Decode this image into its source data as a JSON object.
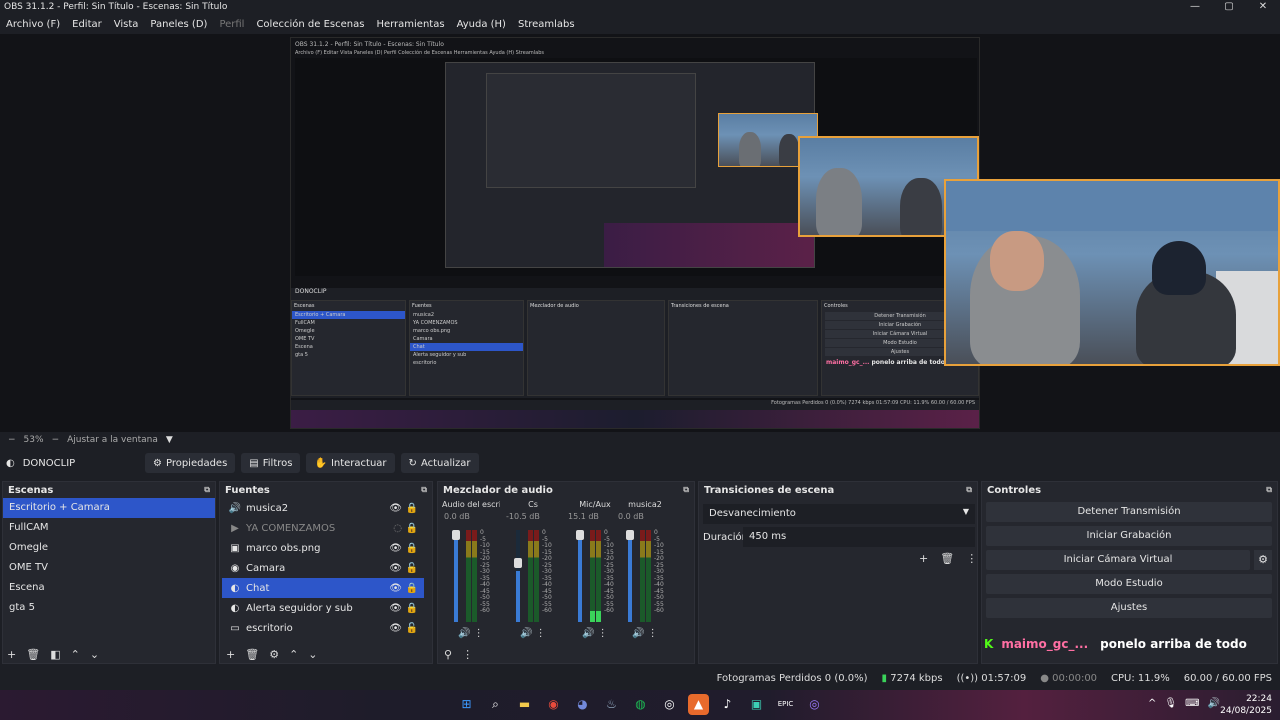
{
  "window": {
    "title": "OBS 31.1.2 - Perfil: Sin Título - Escenas: Sin Título",
    "controls": [
      "—",
      "▢",
      "✕"
    ]
  },
  "menu": [
    "Archivo (F)",
    "Editar",
    "Vista",
    "Paneles (D)",
    "Perfil",
    "Colección de Escenas",
    "Herramientas",
    "Ayuda (H)",
    "Streamlabs"
  ],
  "preview": {
    "nested_title": "OBS 31.1.2 - Perfil: Sin Título - Escenas: Sin Título",
    "nested_menu": "Archivo (F)  Editar  Vista  Paneles (D)  Perfil  Colección de Escenas  Herramientas  Ayuda (H)  Streamlabs",
    "nested_status": "Fotogramas Perdidos 0 (0.0%)   7274 kbps   01:57:09   CPU: 11.9%   60.00 / 60.00 FPS",
    "nested_chat_user": "maimo_gc_...",
    "nested_chat_msg": "ponelo arriba de todo",
    "nested_source": "DONOCLIP",
    "nested_scenes": [
      "Escritorio + Camara",
      "FullCAM",
      "Omegle",
      "OME TV",
      "Escena",
      "gta 5"
    ],
    "nested_sources": [
      "musica2",
      "YA COMENZAMOS",
      "marco obs.png",
      "Camara",
      "Chat",
      "Alerta seguidor y sub",
      "escritorio"
    ],
    "nested_controls": [
      "Detener Transmisión",
      "Iniciar Grabación",
      "Iniciar Cámara Virtual",
      "Modo Estudio",
      "Ajustes"
    ],
    "nested_panels": [
      "Escenas",
      "Fuentes",
      "Mezclador de audio",
      "Transiciones de escena",
      "Controles"
    ]
  },
  "zoom": {
    "level": "53%",
    "fit": "Ajustar a la ventana"
  },
  "source_toolbar": {
    "source_name": "DONOCLIP",
    "properties": "Propiedades",
    "filters": "Filtros",
    "interact": "Interactuar",
    "refresh": "Actualizar"
  },
  "scenes": {
    "title": "Escenas",
    "items": [
      "Escritorio + Camara",
      "FullCAM",
      "Omegle",
      "OME TV",
      "Escena",
      "gta 5"
    ],
    "selected": 0
  },
  "sources": {
    "title": "Fuentes",
    "items": [
      {
        "label": "musica2",
        "icon": "speaker-icon",
        "glyph": "🔊"
      },
      {
        "label": "YA COMENZAMOS",
        "icon": "play-icon",
        "glyph": "▶"
      },
      {
        "label": "marco obs.png",
        "icon": "image-icon",
        "glyph": "▣"
      },
      {
        "label": "Camara",
        "icon": "camera-icon",
        "glyph": "◉"
      },
      {
        "label": "Chat",
        "icon": "browser-icon",
        "glyph": "◐"
      },
      {
        "label": "Alerta seguidor y sub",
        "icon": "browser-icon",
        "glyph": "◐"
      },
      {
        "label": "escritorio",
        "icon": "monitor-icon",
        "glyph": "▭"
      }
    ]
  },
  "mixer": {
    "title": "Mezclador de audio",
    "channels": [
      {
        "name": "Audio del escritorio",
        "db": "0.0 dB",
        "level": 0.0
      },
      {
        "name": "Cs",
        "db": "-10.5 dB",
        "level": 0.0
      },
      {
        "name": "Mic/Aux",
        "db": "15.1 dB",
        "level": 0.12
      },
      {
        "name": "musica2",
        "db": "0.0 dB",
        "level": 0.0
      }
    ],
    "scale": [
      "0",
      "-5",
      "-10",
      "-15",
      "-20",
      "-25",
      "-30",
      "-35",
      "-40",
      "-45",
      "-50",
      "-55",
      "-60"
    ]
  },
  "transitions": {
    "title": "Transiciones de escena",
    "selected": "Desvanecimiento",
    "duration_label": "Duración",
    "duration": "450 ms"
  },
  "controls": {
    "title": "Controles",
    "stop_stream": "Detener Transmisión",
    "start_recording": "Iniciar Grabación",
    "start_virtual_cam": "Iniciar Cámara Virtual",
    "studio_mode": "Modo Estudio",
    "settings": "Ajustes"
  },
  "chat": {
    "user": "maimo_gc_...",
    "message": "ponelo arriba de todo"
  },
  "status": {
    "dropped": "Fotogramas Perdidos 0 (0.0%)",
    "bitrate": "7274 kbps",
    "stream_time": "01:57:09",
    "rec_time": "00:00:00",
    "cpu": "CPU: 11.9%",
    "fps": "60.00 / 60.00 FPS"
  },
  "taskbar": {
    "time": "22:24",
    "date": "24/08/2025"
  },
  "colors": {
    "accent": "#2d56c9",
    "camera_border": "#e8a13b",
    "chat_user": "#ff6fa3"
  }
}
